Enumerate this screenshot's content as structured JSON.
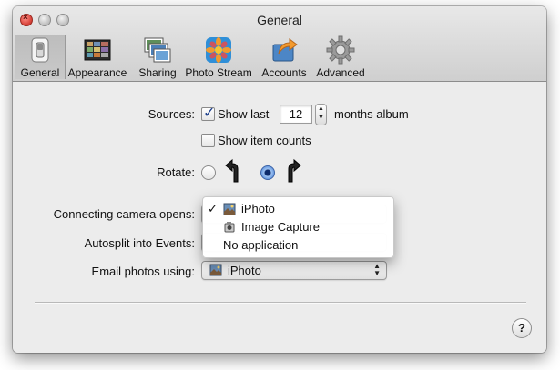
{
  "window": {
    "title": "General"
  },
  "toolbar": {
    "items": [
      {
        "label": "General",
        "icon": "general-switch-icon",
        "selected": true
      },
      {
        "label": "Appearance",
        "icon": "appearance-icon"
      },
      {
        "label": "Sharing",
        "icon": "sharing-photos-icon"
      },
      {
        "label": "Photo Stream",
        "icon": "photo-stream-icon"
      },
      {
        "label": "Accounts",
        "icon": "accounts-arrow-icon"
      },
      {
        "label": "Advanced",
        "icon": "advanced-gear-icon"
      }
    ]
  },
  "sources": {
    "label": "Sources:",
    "show_last_label": "Show last",
    "show_last_checked": true,
    "months_value": "12",
    "months_suffix": "months album",
    "item_counts_label": "Show item counts",
    "item_counts_checked": false
  },
  "rotate": {
    "label": "Rotate:",
    "selected": "clockwise"
  },
  "camera": {
    "label": "Connecting camera opens:",
    "value": "iPhoto",
    "options": [
      {
        "label": "iPhoto",
        "checked": true,
        "icon": "iphoto-icon"
      },
      {
        "label": "Image Capture",
        "checked": false,
        "icon": "image-capture-icon"
      },
      {
        "label": "No application",
        "checked": false
      }
    ]
  },
  "autosplit": {
    "label": "Autosplit into Events:"
  },
  "email": {
    "label": "Email photos using:",
    "value": "iPhoto",
    "icon": "iphoto-icon"
  },
  "help": {
    "label": "?"
  },
  "colors": {
    "accent": "#1b3d8a",
    "window_bg": "#ececec"
  }
}
